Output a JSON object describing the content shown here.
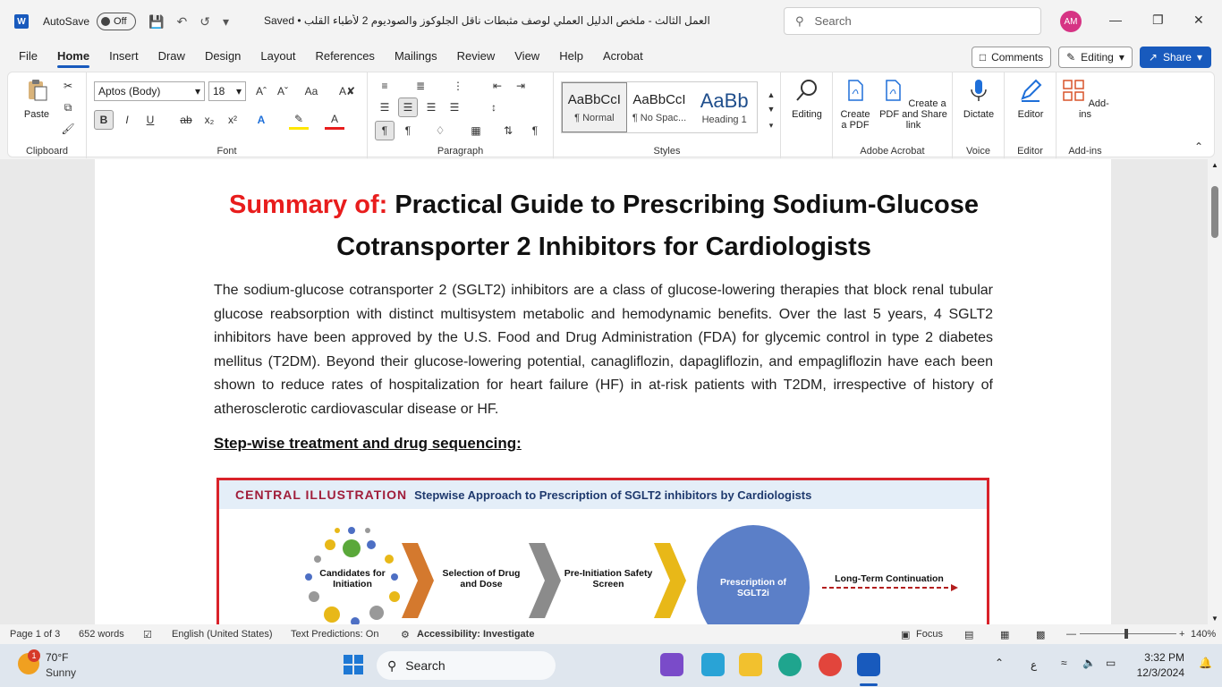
{
  "titlebar": {
    "app_logo": "W",
    "autosave_label": "AutoSave",
    "autosave_state": "Off",
    "doc_title": "العمل الثالث - ملخص الدليل العملي لوصف مثبطات ناقل الجلوكوز والصوديوم 2 لأطباء القلب • Saved",
    "search_placeholder": "Search",
    "avatar_initials": "AM"
  },
  "menu": {
    "tabs": [
      "File",
      "Home",
      "Insert",
      "Draw",
      "Design",
      "Layout",
      "References",
      "Mailings",
      "Review",
      "View",
      "Help",
      "Acrobat"
    ],
    "comments_label": "Comments",
    "editing_label": "Editing",
    "share_label": "Share"
  },
  "ribbon": {
    "clipboard": {
      "label": "Clipboard",
      "paste": "Paste"
    },
    "font": {
      "label": "Font",
      "family": "Aptos (Body)",
      "size": "18"
    },
    "paragraph": {
      "label": "Paragraph"
    },
    "styles": {
      "label": "Styles",
      "items": [
        {
          "sample": "AaBbCcI",
          "name": "¶ Normal"
        },
        {
          "sample": "AaBbCcI",
          "name": "¶ No Spac..."
        },
        {
          "sample": "AaBb",
          "name": "Heading 1"
        }
      ]
    },
    "editing": {
      "label": "Editing"
    },
    "adobe": {
      "label": "Adobe Acrobat",
      "create_pdf": "Create a PDF",
      "create_share": "Create a PDF and Share link"
    },
    "voice": {
      "label": "Voice",
      "dictate": "Dictate"
    },
    "editor": {
      "label": "Editor",
      "editor_btn": "Editor"
    },
    "addins": {
      "label": "Add-ins",
      "addins_btn": "Add-ins"
    }
  },
  "document": {
    "heading_red": "Summary of:",
    "heading_rest": " Practical Guide to Prescribing Sodium-Glucose Cotransporter 2 Inhibitors for Cardiologists",
    "paragraph": "The sodium-glucose cotransporter 2 (SGLT2) inhibitors are a class of glucose-lowering therapies that block renal tubular glucose reabsorption with distinct multisystem metabolic and hemodynamic benefits. Over the last 5 years, 4 SGLT2 inhibitors have been approved by the U.S. Food and Drug Administration (FDA) for glycemic control in type 2 diabetes mellitus (T2DM). Beyond their glucose-lowering potential, canagliflozin, dapagliflozin, and empagliflozin have each been shown to reduce rates of hospitalization for heart failure (HF) in at-risk patients with T2DM, irrespective of history of atherosclerotic cardiovascular disease or HF.",
    "subheading": "Step-wise treatment and drug sequencing:",
    "illustration": {
      "tag": "CENTRAL ILLUSTRATION",
      "title": "Stepwise Approach to Prescription of SGLT2 inhibitors by Cardiologists",
      "step1": "Candidates for Initiation",
      "step2": "Selection of Drug and Dose",
      "step3": "Pre-Initiation Safety Screen",
      "step4": "Prescription of SGLT2i",
      "step5": "Long-Term Continuation"
    }
  },
  "status": {
    "page": "Page 1 of 3",
    "words": "652 words",
    "language": "English (United States)",
    "predictions": "Text Predictions: On",
    "accessibility": "Accessibility: Investigate",
    "focus": "Focus",
    "zoom": "140%"
  },
  "taskbar": {
    "weather_temp": "70°F",
    "weather_desc": "Sunny",
    "weather_badge": "1",
    "search_label": "Search",
    "lang": "ع",
    "time": "3:32 PM",
    "date": "12/3/2024"
  },
  "colors": {
    "word_blue": "#185abd",
    "heading_red": "#e81d1d",
    "illus_border": "#d9222a"
  }
}
